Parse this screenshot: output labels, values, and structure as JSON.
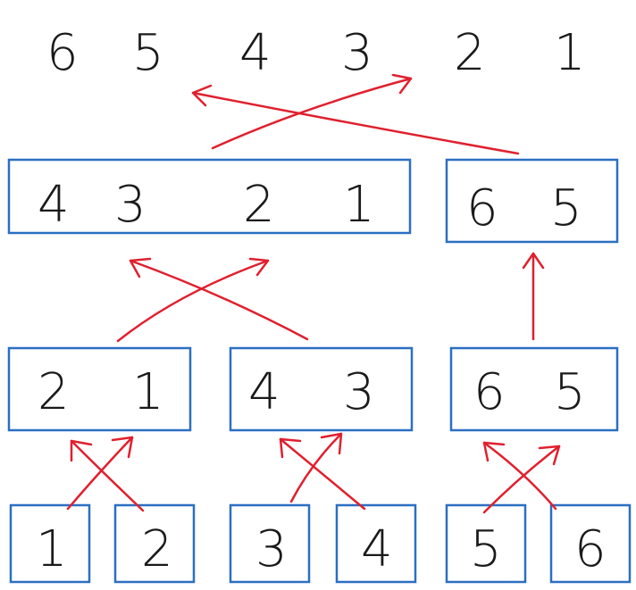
{
  "top_row": {
    "digits": [
      "6",
      "5",
      "4",
      "3",
      "2",
      "1"
    ]
  },
  "level_3": {
    "left_box": [
      "4",
      "3",
      "2",
      "1"
    ],
    "right_box": [
      "6",
      "5"
    ]
  },
  "level_2": {
    "box_a": [
      "2",
      "1"
    ],
    "box_b": [
      "4",
      "3"
    ],
    "box_c": [
      "6",
      "5"
    ]
  },
  "level_1": {
    "boxes": [
      "1",
      "2",
      "3",
      "4",
      "5",
      "6"
    ]
  },
  "colors": {
    "box_stroke": "#2b6fc2",
    "arrow_stroke": "#e0202e",
    "digit_fill": "#1a1a1a"
  }
}
